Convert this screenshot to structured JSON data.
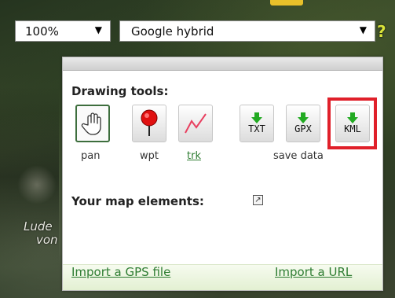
{
  "map": {
    "place_label_line1": "Lude",
    "place_label_line2": "von"
  },
  "controls": {
    "zoom_value": "100%",
    "layer_value": "Google hybrid",
    "help_label": "?",
    "dropdown_arrow": "▼"
  },
  "panel": {
    "drawing_tools_title": "Drawing tools:",
    "tools": {
      "pan": "pan",
      "wpt": "wpt",
      "trk": "trk"
    },
    "save_buttons": {
      "txt": "TXT",
      "gpx": "GPX",
      "kml": "KML"
    },
    "save_data_label": "save data",
    "map_elements_title": "Your map elements:",
    "external_icon_glyph": "↗",
    "links": {
      "import_gps": "Import a GPS file",
      "import_url": "Import a URL"
    }
  },
  "colors": {
    "highlight": "#e0202a",
    "link": "#2e7d32",
    "save_arrow": "#22aa22",
    "waypoint_pin": "#e01010",
    "track_line": "#e84060"
  }
}
